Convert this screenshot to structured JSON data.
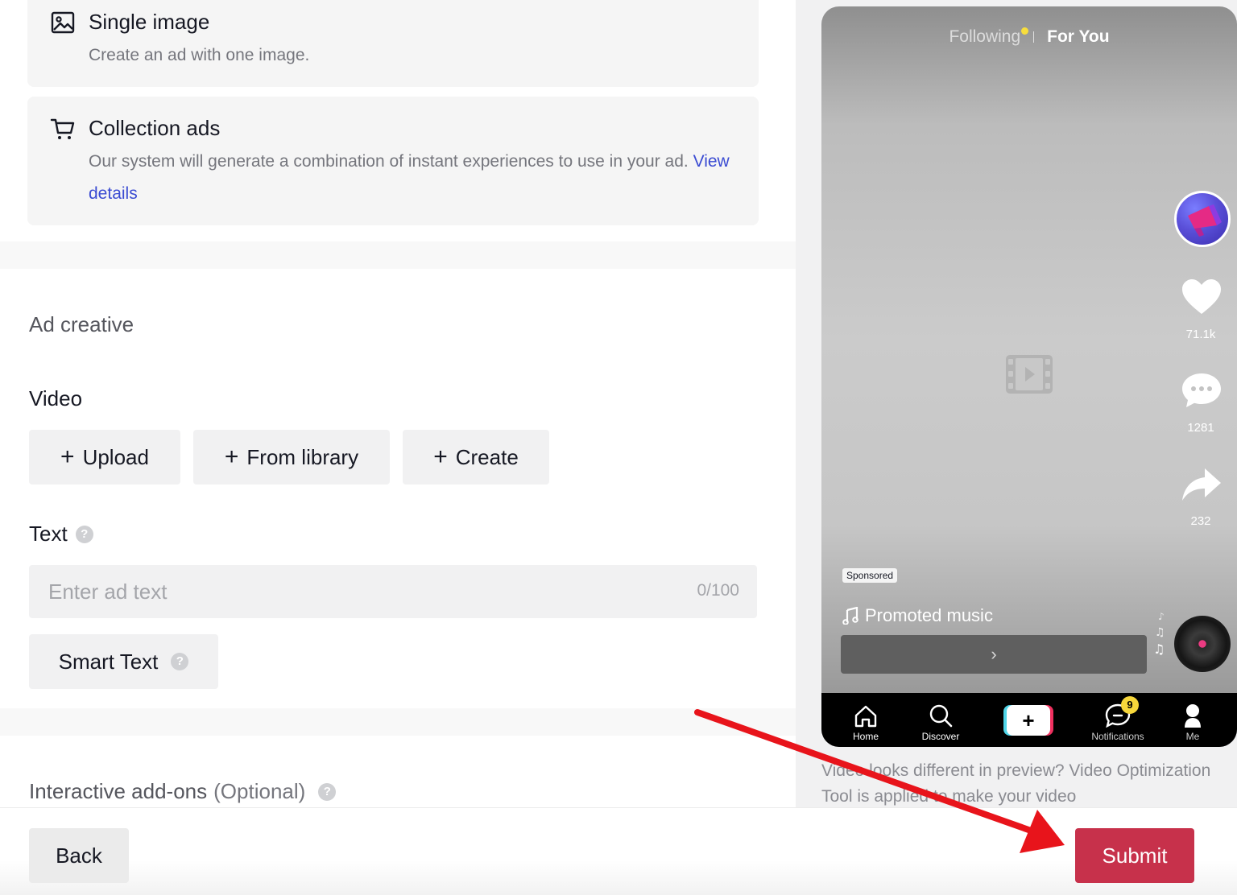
{
  "formats": [
    {
      "title": "Single image",
      "description": "Create an ad with one image.",
      "icon": "image-icon"
    },
    {
      "title": "Collection ads",
      "description": "Our system will generate a combination of instant experiences to use in your ad.",
      "link_text": "View details",
      "icon": "cart-icon"
    }
  ],
  "ad_creative": {
    "section_title": "Ad creative",
    "video": {
      "label": "Video",
      "buttons": {
        "upload": "Upload",
        "from_library": "From library",
        "create": "Create"
      }
    },
    "text": {
      "label": "Text",
      "placeholder": "Enter ad text",
      "value": "",
      "counter": "0/100",
      "help": "?"
    },
    "smart_text": {
      "label": "Smart Text",
      "help": "?"
    },
    "interactive_addons": {
      "label": "Interactive add-ons",
      "optional": "(Optional)",
      "help": "?"
    }
  },
  "preview": {
    "tabs": {
      "following": "Following",
      "for_you": "For You"
    },
    "counts": {
      "likes": "71.1k",
      "comments": "1281",
      "shares": "232"
    },
    "sponsored": "Sponsored",
    "music": "Promoted music",
    "cta_chevron": "›",
    "nav": {
      "home": "Home",
      "discover": "Discover",
      "create": "+",
      "notifications": "Notifications",
      "notifications_badge": "9",
      "me": "Me"
    },
    "note": "Video looks different in preview? Video Optimization Tool is applied to make your video"
  },
  "footer": {
    "back": "Back",
    "submit": "Submit"
  },
  "colors": {
    "submit": "#c7314b",
    "link": "#3a4bd2",
    "annotation_arrow": "#e8141b"
  }
}
